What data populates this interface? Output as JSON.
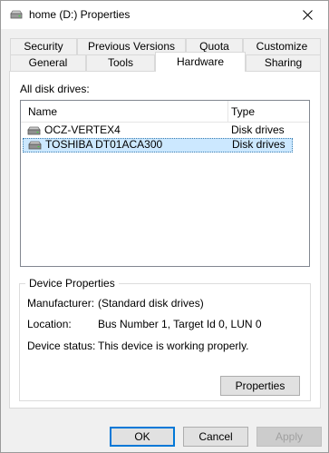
{
  "window": {
    "title": "home (D:) Properties",
    "title_icon": "drive-icon",
    "close_icon": "close-icon"
  },
  "tabs": {
    "row1": [
      "Security",
      "Previous Versions",
      "Quota",
      "Customize"
    ],
    "row2": [
      "General",
      "Tools",
      "Hardware",
      "Sharing"
    ],
    "active": "Hardware"
  },
  "hardware": {
    "list_label": "All disk drives:",
    "columns": {
      "name": "Name",
      "type": "Type"
    },
    "drives": [
      {
        "name": "OCZ-VERTEX4",
        "type": "Disk drives",
        "icon": "disk-drive-icon",
        "selected": false
      },
      {
        "name": "TOSHIBA DT01ACA300",
        "type": "Disk drives",
        "icon": "disk-drive-icon",
        "selected": true
      }
    ],
    "device_properties": {
      "title": "Device Properties",
      "manufacturer_label": "Manufacturer:",
      "manufacturer_value": "(Standard disk drives)",
      "location_label": "Location:",
      "location_value": "Bus Number 1, Target Id 0, LUN 0",
      "status_label": "Device status:",
      "status_value": "This device is working properly.",
      "properties_button": "Properties"
    }
  },
  "footer": {
    "ok": "OK",
    "cancel": "Cancel",
    "apply": "Apply"
  },
  "colors": {
    "selection": "#cce8ff",
    "accent": "#0078d7"
  }
}
